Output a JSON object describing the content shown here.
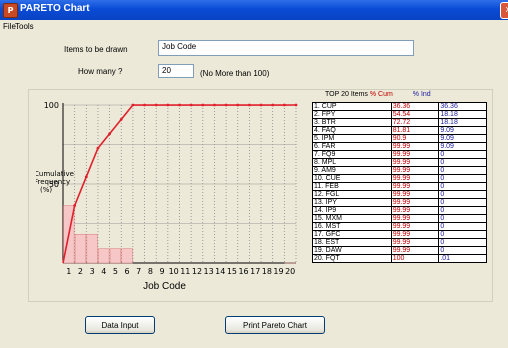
{
  "window": {
    "title": "PARETO Chart",
    "icon": "pareto-app-icon",
    "close_glyph": "x"
  },
  "menu": [
    "File",
    "Tools"
  ],
  "form": {
    "items_label": "Items to be drawn",
    "items_value": "Job Code",
    "how_many_label": "How many ?",
    "how_many_value": "20",
    "how_many_hint": "(No More than 100)"
  },
  "table": {
    "header_title": "TOP 20 Items",
    "header_cum": "% Cum",
    "header_ind": "% Ind",
    "rows": [
      {
        "item": "1. CUP",
        "cum": "36.36",
        "ind": "36.36"
      },
      {
        "item": "2. FPY",
        "cum": "54.54",
        "ind": "18.18"
      },
      {
        "item": "3. BTR",
        "cum": "72.72",
        "ind": "18.18"
      },
      {
        "item": "4. FAQ",
        "cum": "81.81",
        "ind": "9.09"
      },
      {
        "item": "5. IPM",
        "cum": "90.9",
        "ind": "9.09"
      },
      {
        "item": "6. FAR",
        "cum": "99.99",
        "ind": "9.09"
      },
      {
        "item": "7. FQ9",
        "cum": "99.99",
        "ind": "0"
      },
      {
        "item": "8. MPL",
        "cum": "99.99",
        "ind": "0"
      },
      {
        "item": "9. AM9",
        "cum": "99.99",
        "ind": "0"
      },
      {
        "item": "10. CUE",
        "cum": "99.99",
        "ind": "0"
      },
      {
        "item": "11. FEB",
        "cum": "99.99",
        "ind": "0"
      },
      {
        "item": "12. FGL",
        "cum": "99.99",
        "ind": "0"
      },
      {
        "item": "13. IPY",
        "cum": "99.99",
        "ind": "0"
      },
      {
        "item": "14. IP9",
        "cum": "99.99",
        "ind": "0"
      },
      {
        "item": "15. MXM",
        "cum": "99.99",
        "ind": "0"
      },
      {
        "item": "16. MST",
        "cum": "99.99",
        "ind": "0"
      },
      {
        "item": "17. GFC",
        "cum": "99.99",
        "ind": "0"
      },
      {
        "item": "18. EST",
        "cum": "99.99",
        "ind": "0"
      },
      {
        "item": "19. DAW",
        "cum": "99.99",
        "ind": "0"
      },
      {
        "item": "20. FQT",
        "cum": "100",
        "ind": ".01"
      }
    ]
  },
  "chart_data": {
    "type": "bar",
    "ylabel": "Cumulative\nFrequency\n(%)",
    "xlabel": "Job Code",
    "ylim": [
      0,
      100
    ],
    "yticks": [
      "100",
      "50"
    ],
    "categories": [
      "1",
      "2",
      "3",
      "4",
      "5",
      "6",
      "7",
      "8",
      "9",
      "10",
      "11",
      "12",
      "13",
      "14",
      "15",
      "16",
      "17",
      "18",
      "19",
      "20"
    ],
    "series": [
      {
        "values": [
          36.36,
          18.18,
          18.18,
          9.09,
          9.09,
          9.09,
          0,
          0,
          0,
          0,
          0,
          0,
          0,
          0,
          0,
          0,
          0,
          0,
          0,
          0.01
        ]
      },
      {
        "values": [
          36.36,
          54.54,
          72.72,
          81.81,
          90.9,
          99.99,
          99.99,
          99.99,
          99.99,
          99.99,
          99.99,
          99.99,
          99.99,
          99.99,
          99.99,
          99.99,
          99.99,
          99.99,
          99.99,
          100
        ]
      }
    ],
    "colors": {
      "bar_fill": "#F7C7C7",
      "bar_stroke": "#D88",
      "line": "#E0202A",
      "grid": "#888"
    }
  },
  "buttons": {
    "data_input": "Data Input",
    "print": "Print Pareto Chart"
  }
}
